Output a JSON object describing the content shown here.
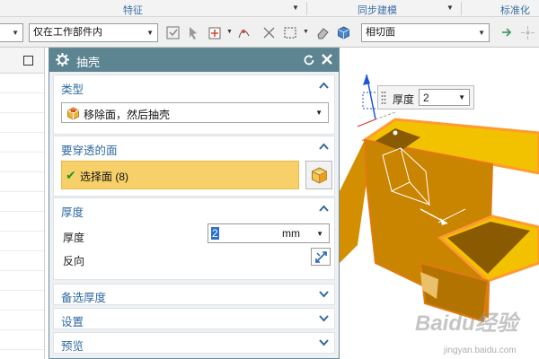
{
  "ribbon": {
    "group_feature": "特征",
    "group_sync": "同步建模",
    "group_standard": "标准化工"
  },
  "toolbar": {
    "scope_value": "仅在工作部件内",
    "snap_value": "相切面"
  },
  "dialog": {
    "title": "抽壳",
    "type_section": {
      "title": "类型",
      "dropdown_value": "移除面，然后抽壳"
    },
    "pierce_section": {
      "title": "要穿透的面",
      "select_label": "选择面 (8)"
    },
    "thickness_section": {
      "title": "厚度",
      "thickness_label": "厚度",
      "thickness_value": "2",
      "unit": "mm",
      "reverse_label": "反向"
    },
    "alt_thickness_title": "备选厚度",
    "settings_title": "设置",
    "preview_title": "预览"
  },
  "float_input": {
    "label": "厚度",
    "value": "2"
  },
  "watermark": {
    "main": "Baidu经验",
    "sub": "jingyan.baidu.com"
  },
  "colors": {
    "accent": "#2f6aa3",
    "dialog_header": "#5c8491",
    "selection": "#f7d06a",
    "model_orange": "#d89a00"
  }
}
